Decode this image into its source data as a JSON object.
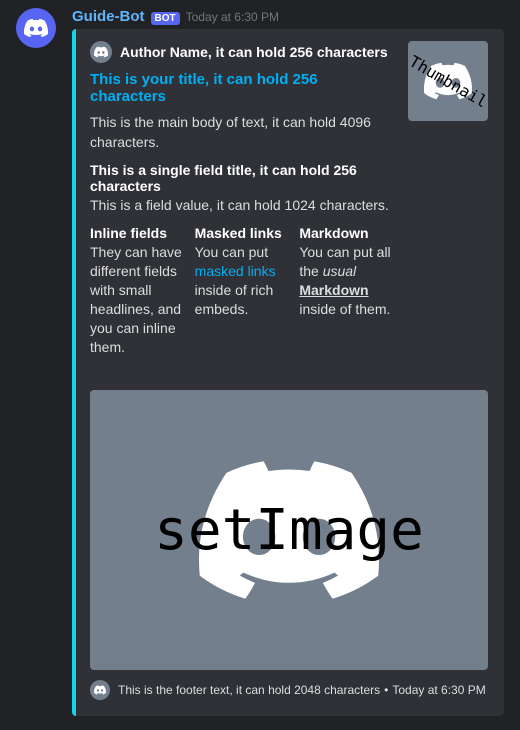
{
  "colors": {
    "embed_stripe": "#14d5e7",
    "link": "#00aff4",
    "username": "#5fb6f9",
    "bg": "#202225",
    "embed_bg": "#2f3136"
  },
  "message": {
    "username": "Guide-Bot",
    "bot_tag": "BOT",
    "timestamp": "Today at 6:30 PM"
  },
  "embed": {
    "author": "Author Name, it can hold 256 characters",
    "title": "This is your title, it can hold 256 characters",
    "description": "This is the main body of text, it can hold 4096 characters.",
    "thumbnail_label": "Thumbnail",
    "image_label": "setImage",
    "fields": [
      {
        "title": "This is a single field title, it can hold 256 characters",
        "value": "This is a field value, it can hold 1024 characters."
      }
    ],
    "inline_fields": [
      {
        "title": "Inline fields",
        "value": "They can have different fields with small headlines, and you can inline them."
      },
      {
        "title": "Masked links",
        "value_pre": "You can put ",
        "value_link": "masked links",
        "value_post": " inside of rich embeds."
      },
      {
        "title": "Markdown",
        "value_pre": "You can put all the ",
        "value_em": "usual",
        "value_sp": " ",
        "value_bu": "Markdown",
        "value_post": " inside of them."
      }
    ],
    "footer": {
      "text": "This is the footer text, it can hold 2048 characters",
      "separator": "•",
      "timestamp": "Today at 6:30 PM"
    }
  }
}
